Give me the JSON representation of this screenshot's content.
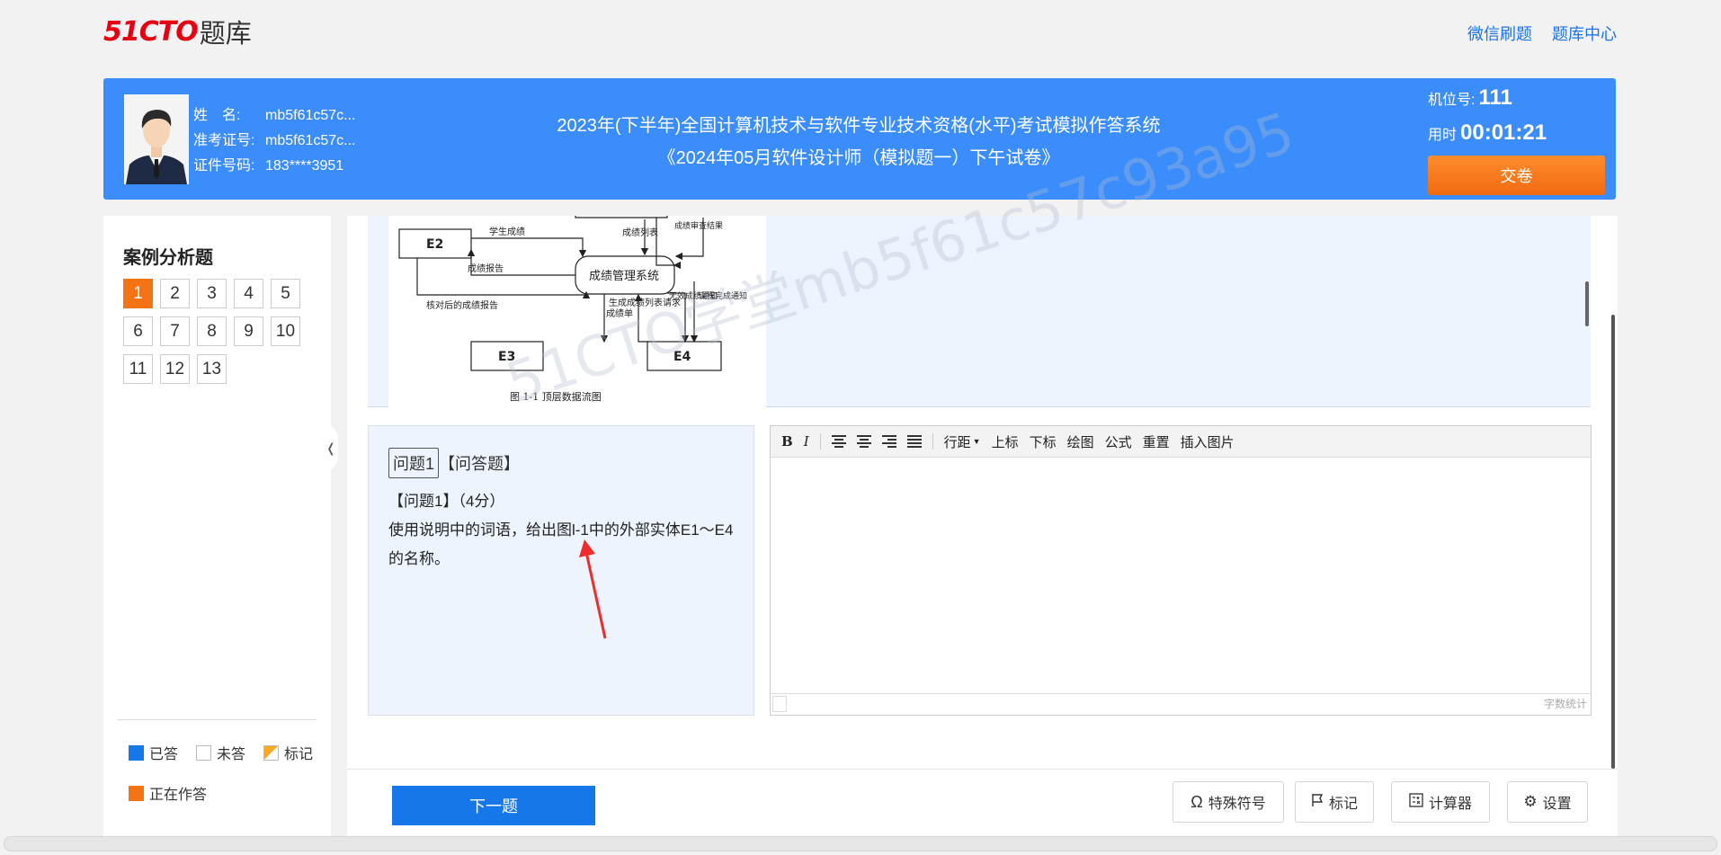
{
  "logo": {
    "brand": "51CTO",
    "suffix": "题库"
  },
  "top_links": [
    "微信刷题",
    "题库中心"
  ],
  "candidate": {
    "name_label": "姓　名:",
    "name": "mb5f61c57c...",
    "ticket_label": "准考证号:",
    "ticket": "mb5f61c57c...",
    "id_label": "证件号码:",
    "id": "183****3951"
  },
  "exam": {
    "system_title": "2023年(下半年)全国计算机技术与软件专业技术资格(水平)考试模拟作答系统",
    "paper_title": "《2024年05月软件设计师（模拟题一）下午试卷》"
  },
  "seat": {
    "label": "机位号:",
    "value": "111"
  },
  "timer": {
    "label": "用时",
    "value": "00:01:21"
  },
  "submit_label": "交卷",
  "sidebar": {
    "title": "案例分析题",
    "questions": [
      "1",
      "2",
      "3",
      "4",
      "5",
      "6",
      "7",
      "8",
      "9",
      "10",
      "11",
      "12",
      "13"
    ],
    "current": "1",
    "legend": {
      "answered": "已答",
      "unanswered": "未答",
      "marked": "标记",
      "in_progress": "正在作答"
    }
  },
  "figure": {
    "caption": "图 1-1  顶层数据流图",
    "system": "成绩管理系统",
    "entities": [
      "E2",
      "E3",
      "E4"
    ],
    "flows": {
      "f1": "学生成绩",
      "f2": "成绩报告",
      "f3": "核对后的成绩报告",
      "f4": "成绩列表",
      "f5": "成绩审查结果",
      "f6": "成绩单",
      "f7": "生成成绩列表请求",
      "f8": "无效成绩通知",
      "f9": "课程完成通知"
    }
  },
  "watermark": "51CTO学堂mb5f61c57c93a95",
  "question": {
    "tag": "问题1",
    "type": "【问答题】",
    "header": "【问题1】（4分）",
    "text": "使用说明中的词语，给出图l-1中的外部实体E1～E4的名称。"
  },
  "editor": {
    "tools": [
      "行距",
      "上标",
      "下标",
      "绘图",
      "公式",
      "重置",
      "插入图片"
    ],
    "word_count": "字数统计"
  },
  "footer": {
    "next_label": "下一题",
    "special_chars": "特殊符号",
    "mark": "标记",
    "calculator": "计算器",
    "settings": "设置"
  },
  "colors": {
    "accent": "#3a8dfa",
    "submit": "#f47314",
    "next": "#1677e8"
  }
}
